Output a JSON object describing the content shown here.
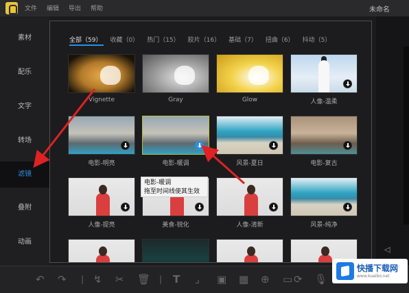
{
  "titlebar": {
    "menu": [
      "文件",
      "编辑",
      "导出",
      "帮助"
    ],
    "doc_title": "未命名"
  },
  "sidebar": {
    "items": [
      {
        "label": "素材"
      },
      {
        "label": "配乐"
      },
      {
        "label": "文字"
      },
      {
        "label": "转场"
      },
      {
        "label": "滤镜",
        "active": true
      },
      {
        "label": "叠附"
      },
      {
        "label": "动画"
      }
    ]
  },
  "tabs": [
    {
      "label": "全部（59）",
      "active": true
    },
    {
      "label": "收藏（0）"
    },
    {
      "label": "热门（15）"
    },
    {
      "label": "胶片（16）"
    },
    {
      "label": "基础（7）"
    },
    {
      "label": "扭曲（6）"
    },
    {
      "label": "抖动（5）"
    }
  ],
  "filters": [
    {
      "label": "Vignette",
      "style": "cat-vignette"
    },
    {
      "label": "Gray",
      "style": "cat-gray"
    },
    {
      "label": "Glow",
      "style": "cat-glow"
    },
    {
      "label": "人像-温柔",
      "style": "portrait-sky",
      "download": true
    },
    {
      "label": "电影-明亮",
      "style": "city",
      "download": true
    },
    {
      "label": "电影-暖调",
      "style": "city",
      "download": true,
      "selected": true
    },
    {
      "label": "风景-夏日",
      "style": "beach",
      "download": true
    },
    {
      "label": "电影-复古",
      "style": "city-warm",
      "download": true
    },
    {
      "label": "人像-提亮",
      "style": "person-red",
      "download": true
    },
    {
      "label": "美食-锐化",
      "style": "person-red",
      "download": true
    },
    {
      "label": "人像-清新",
      "style": "person-red",
      "download": true
    },
    {
      "label": "风景-纯净",
      "style": "beach",
      "download": true
    },
    {
      "label": "",
      "style": "person-red"
    },
    {
      "label": "",
      "style": "food-dark"
    },
    {
      "label": "",
      "style": "person-red"
    },
    {
      "label": "",
      "style": "person-red"
    }
  ],
  "tooltip": {
    "line1": "电影-暖调",
    "line2": "拖至时间线使其生效"
  },
  "watermark": {
    "title": "快播下载网",
    "sub": "www.kuaibo.net"
  },
  "colors": {
    "accent": "#2b8fe0",
    "arrow": "#e02222",
    "selected_border": "#b7c43a"
  },
  "toolbar_icons": [
    "undo-icon",
    "redo-icon",
    "split-icon",
    "cut-icon",
    "delete-icon",
    "text-icon",
    "crop-icon",
    "frame-icon",
    "mosaic-icon",
    "zoom-icon",
    "rotate-icon",
    "mic-icon"
  ]
}
